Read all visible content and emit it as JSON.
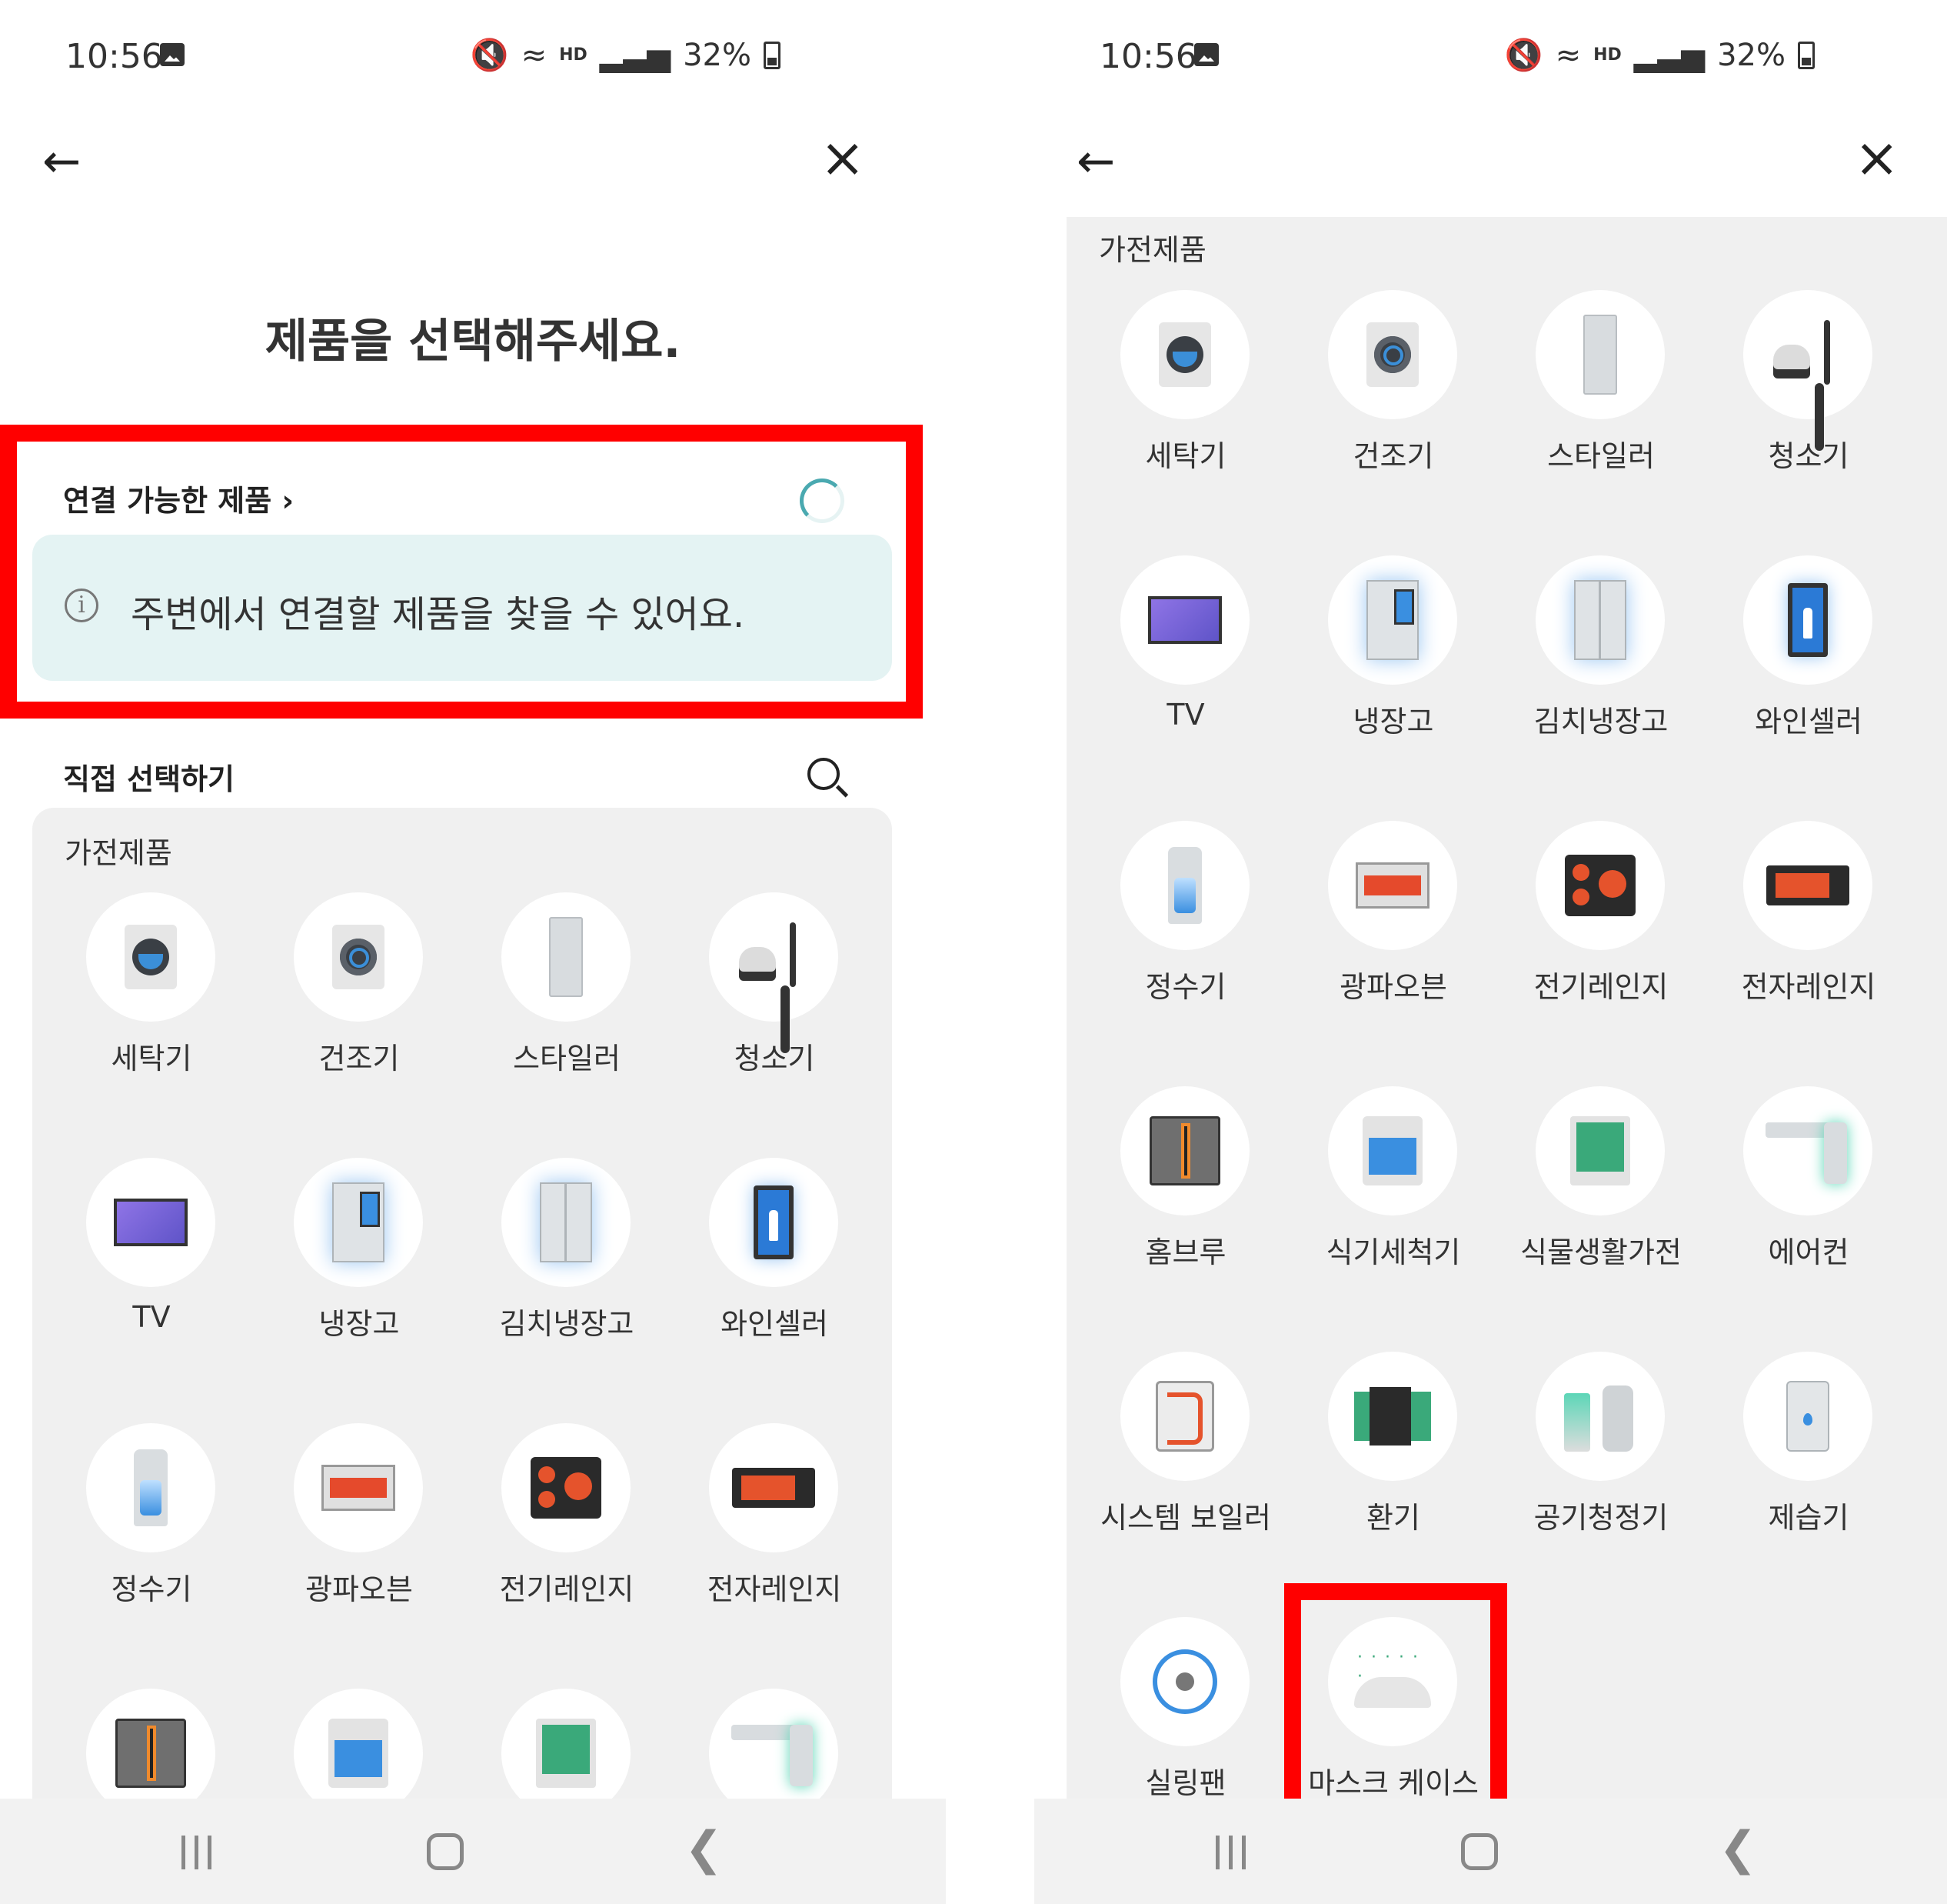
{
  "status": {
    "time": "10:56",
    "hd": "HD",
    "battery": "32%"
  },
  "left": {
    "title": "제품을 선택해주세요.",
    "available_label": "연결 가능한 제품",
    "info_message": "주변에서 연결할 제품을 찾을 수 있어요.",
    "direct_label": "직접 선택하기",
    "panel_title": "가전제품",
    "items": [
      {
        "label": "세탁기",
        "icon": "washer"
      },
      {
        "label": "건조기",
        "icon": "dryer"
      },
      {
        "label": "스타일러",
        "icon": "styler"
      },
      {
        "label": "청소기",
        "icon": "vacuum"
      },
      {
        "label": "TV",
        "icon": "tv"
      },
      {
        "label": "냉장고",
        "icon": "fridge"
      },
      {
        "label": "김치냉장고",
        "icon": "kimchi"
      },
      {
        "label": "와인셀러",
        "icon": "wine"
      },
      {
        "label": "정수기",
        "icon": "purifier"
      },
      {
        "label": "광파오븐",
        "icon": "oven"
      },
      {
        "label": "전기레인지",
        "icon": "cooktop"
      },
      {
        "label": "전자레인지",
        "icon": "micro"
      }
    ]
  },
  "right": {
    "panel_title": "가전제품",
    "items": [
      {
        "label": "세탁기",
        "icon": "washer"
      },
      {
        "label": "건조기",
        "icon": "dryer"
      },
      {
        "label": "스타일러",
        "icon": "styler"
      },
      {
        "label": "청소기",
        "icon": "vacuum"
      },
      {
        "label": "TV",
        "icon": "tv"
      },
      {
        "label": "냉장고",
        "icon": "fridge"
      },
      {
        "label": "김치냉장고",
        "icon": "kimchi"
      },
      {
        "label": "와인셀러",
        "icon": "wine"
      },
      {
        "label": "정수기",
        "icon": "purifier"
      },
      {
        "label": "광파오븐",
        "icon": "oven"
      },
      {
        "label": "전기레인지",
        "icon": "cooktop"
      },
      {
        "label": "전자레인지",
        "icon": "micro"
      },
      {
        "label": "홈브루",
        "icon": "homebrew"
      },
      {
        "label": "식기세척기",
        "icon": "dish"
      },
      {
        "label": "식물생활가전",
        "icon": "plant"
      },
      {
        "label": "에어컨",
        "icon": "aircon"
      },
      {
        "label": "시스템 보일러",
        "icon": "boiler"
      },
      {
        "label": "환기",
        "icon": "vent"
      },
      {
        "label": "공기청정기",
        "icon": "airpur"
      },
      {
        "label": "제습기",
        "icon": "dehum"
      },
      {
        "label": "실링팬",
        "icon": "fan"
      },
      {
        "label": "마스크 케이스",
        "icon": "maskcase"
      }
    ]
  },
  "colors": {
    "highlight": "#ff0000",
    "info_bg": "#e4f3f3",
    "panel_bg": "#f0f0f0"
  }
}
